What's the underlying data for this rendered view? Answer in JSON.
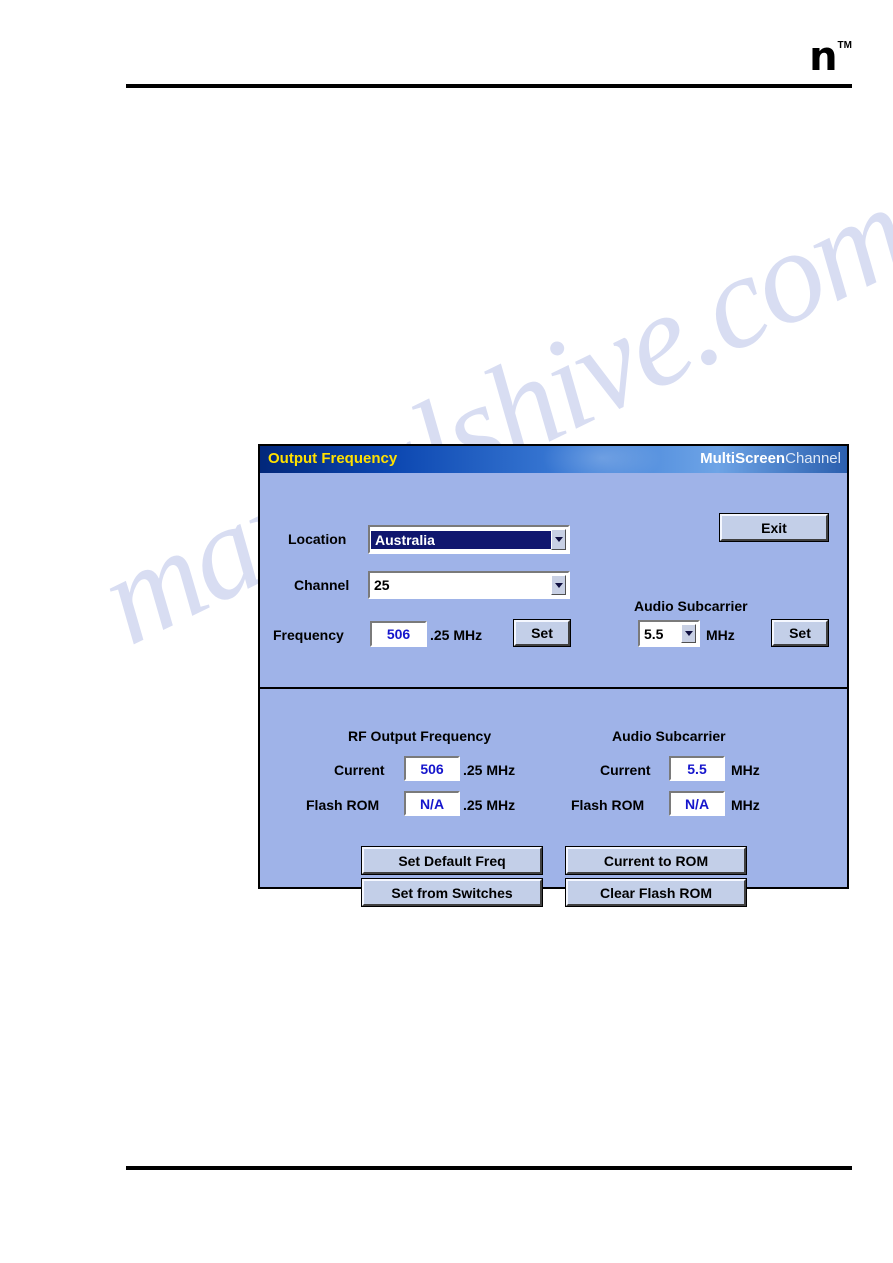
{
  "page": {
    "watermark_text": "manualshive.com",
    "logo_glyph": "n",
    "logo_tm": "TM"
  },
  "dialog": {
    "title": "Output Frequency",
    "brand_bold": "MultiScreen",
    "brand_light": "Channel",
    "exit_button": "Exit",
    "top_section": {
      "location_label": "Location",
      "location_value": "Australia",
      "channel_label": "Channel",
      "channel_value": "25",
      "frequency_label": "Frequency",
      "frequency_value": "506",
      "frequency_suffix": ".25 MHz",
      "frequency_set_button": "Set",
      "audio_subcarrier_heading": "Audio Subcarrier",
      "audio_subcarrier_value": "5.5",
      "audio_subcarrier_unit": "MHz",
      "audio_set_button": "Set"
    },
    "status_section": {
      "rf_heading": "RF Output Frequency",
      "audio_heading": "Audio Subcarrier",
      "rf_current_label": "Current",
      "rf_current_value": "506",
      "rf_current_suffix": ".25 MHz",
      "rf_flash_label": "Flash ROM",
      "rf_flash_value": "N/A",
      "rf_flash_suffix": ".25 MHz",
      "audio_current_label": "Current",
      "audio_current_value": "5.5",
      "audio_current_suffix": "MHz",
      "audio_flash_label": "Flash ROM",
      "audio_flash_value": "N/A",
      "audio_flash_suffix": "MHz"
    },
    "actions": {
      "set_default_freq": "Set Default Freq",
      "current_to_rom": "Current to ROM",
      "set_from_switches": "Set from Switches",
      "clear_flash_rom": "Clear Flash ROM"
    }
  },
  "colors": {
    "dialog_background": "#9fb3e8",
    "title_text": "#ffe000",
    "value_text": "#1515cc",
    "selection_background": "#10166e"
  }
}
